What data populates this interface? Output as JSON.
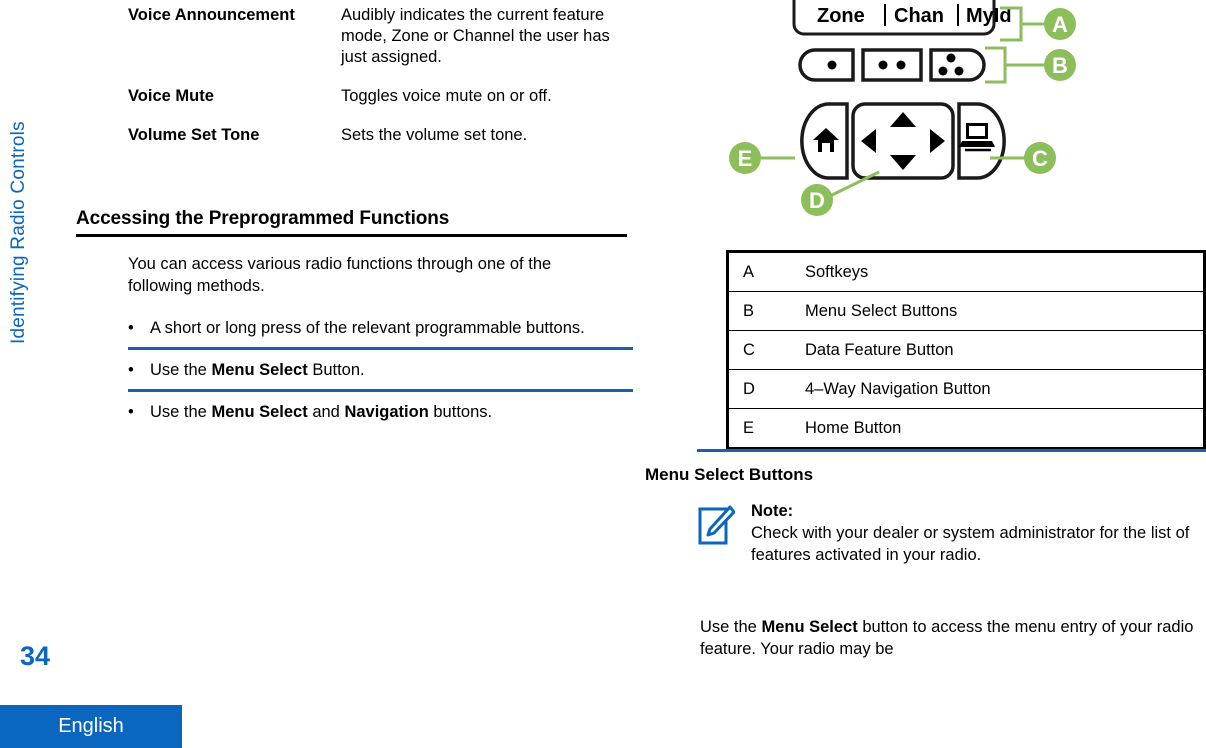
{
  "sidebar": {
    "chapter": "Identifying Radio Controls",
    "page_number": "34",
    "language_tab": "English",
    "accent_color": "#0a66bf"
  },
  "left_column": {
    "definitions": [
      {
        "term": "Voice Announcement",
        "description": "Audibly indicates the current feature mode, Zone or Channel the user has just assigned."
      },
      {
        "term": "Voice Mute",
        "description": "Toggles voice mute on or off."
      },
      {
        "term": "Volume Set Tone",
        "description": "Sets the volume set tone."
      }
    ],
    "section_heading": "Accessing the Preprogrammed Functions",
    "intro": "You can access various radio functions through one of the following methods.",
    "bullets": [
      {
        "bullet": "•",
        "text_1": "A short or long press of the relevant programmable buttons.",
        "bold_1": "",
        "text_2": "",
        "bold_2": "",
        "text_3": ""
      },
      {
        "bullet": "•",
        "text_1": "Use the ",
        "bold_1": "Menu Select",
        "text_2": " Button.",
        "bold_2": "",
        "text_3": ""
      },
      {
        "bullet": "•",
        "text_1": "Use the ",
        "bold_1": "Menu Select",
        "text_2": " and ",
        "bold_2": "Navigation",
        "text_3": " buttons."
      }
    ],
    "rule_color": "#1763a8"
  },
  "right_column": {
    "diagram": {
      "softkeys": [
        "Zone",
        "Chan",
        "MyId"
      ],
      "menu_select_dots": [
        1,
        2,
        3
      ],
      "home_icon": "home-icon",
      "nav_icon": "four-way-navigation-icon",
      "data_icon": "laptop-icon",
      "callouts": [
        "A",
        "B",
        "C",
        "D",
        "E"
      ],
      "callout_color": "#8dbe5c"
    },
    "legend_rows": [
      {
        "key": "A",
        "label": "Softkeys"
      },
      {
        "key": "B",
        "label": "Menu Select Buttons"
      },
      {
        "key": "C",
        "label": "Data Feature Button"
      },
      {
        "key": "D",
        "label": "4–Way Navigation Button"
      },
      {
        "key": "E",
        "label": "Home Button"
      }
    ],
    "sub_heading": "Menu Select Buttons",
    "note": {
      "icon": "note-edit-icon",
      "title": "Note:",
      "body": "Check with your dealer or system administrator for the list of features activated in your radio."
    },
    "closing": {
      "text_1": "Use the ",
      "bold_1": "Menu Select",
      "text_2": " button to access the menu entry of your radio feature. Your radio may be"
    }
  }
}
